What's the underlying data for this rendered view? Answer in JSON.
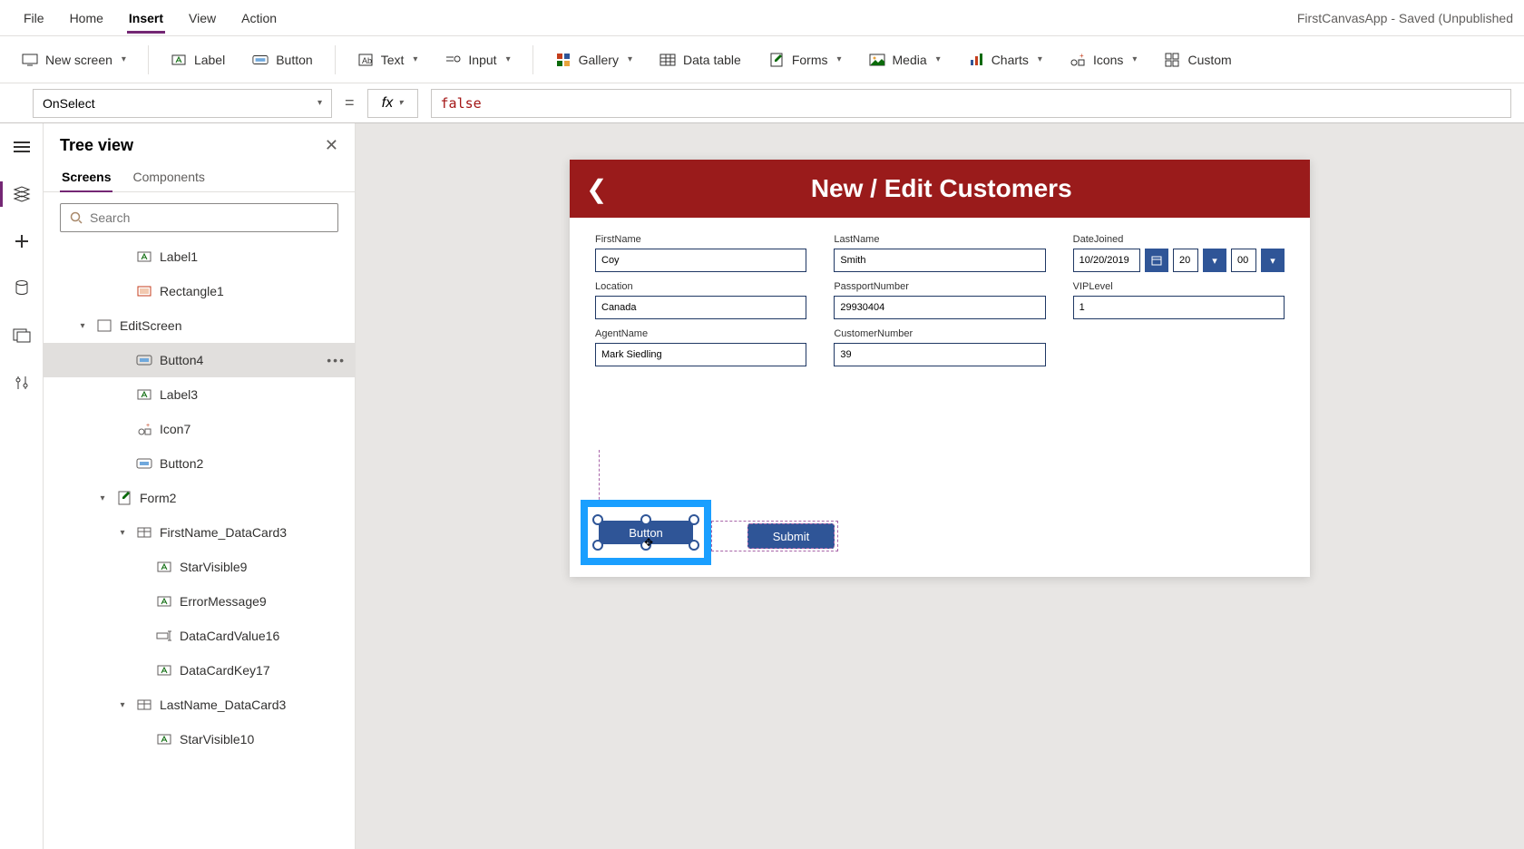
{
  "app_title": "FirstCanvasApp - Saved (Unpublished",
  "menubar": [
    "File",
    "Home",
    "Insert",
    "View",
    "Action"
  ],
  "menubar_active": 2,
  "ribbon": {
    "new_screen": "New screen",
    "label": "Label",
    "button": "Button",
    "text": "Text",
    "input": "Input",
    "gallery": "Gallery",
    "data_table": "Data table",
    "forms": "Forms",
    "media": "Media",
    "charts": "Charts",
    "icons": "Icons",
    "custom": "Custom"
  },
  "formula": {
    "property": "OnSelect",
    "fx": "fx",
    "value": "false"
  },
  "tree": {
    "title": "Tree view",
    "tabs": [
      "Screens",
      "Components"
    ],
    "tabs_active": 0,
    "search_placeholder": "Search",
    "items": [
      {
        "indent": 3,
        "icon": "label",
        "label": "Label1"
      },
      {
        "indent": 3,
        "icon": "rect",
        "label": "Rectangle1"
      },
      {
        "indent": 1,
        "icon": "screen",
        "label": "EditScreen",
        "caret": "v"
      },
      {
        "indent": 3,
        "icon": "button",
        "label": "Button4",
        "selected": true,
        "dots": true
      },
      {
        "indent": 3,
        "icon": "label",
        "label": "Label3"
      },
      {
        "indent": 3,
        "icon": "icon",
        "label": "Icon7"
      },
      {
        "indent": 3,
        "icon": "button",
        "label": "Button2"
      },
      {
        "indent": 2,
        "icon": "form",
        "label": "Form2",
        "caret": "v"
      },
      {
        "indent": 3,
        "icon": "card",
        "label": "FirstName_DataCard3",
        "caret": "v"
      },
      {
        "indent": 4,
        "icon": "label",
        "label": "StarVisible9"
      },
      {
        "indent": 4,
        "icon": "label",
        "label": "ErrorMessage9"
      },
      {
        "indent": 4,
        "icon": "input",
        "label": "DataCardValue16"
      },
      {
        "indent": 4,
        "icon": "label",
        "label": "DataCardKey17"
      },
      {
        "indent": 3,
        "icon": "card",
        "label": "LastName_DataCard3",
        "caret": "v"
      },
      {
        "indent": 4,
        "icon": "label",
        "label": "StarVisible10"
      }
    ]
  },
  "form": {
    "title": "New / Edit Customers",
    "fields": {
      "firstname": {
        "label": "FirstName",
        "value": "Coy"
      },
      "lastname": {
        "label": "LastName",
        "value": "Smith"
      },
      "datejoined": {
        "label": "DateJoined",
        "date": "10/20/2019",
        "hour": "20",
        "minute": "00"
      },
      "location": {
        "label": "Location",
        "value": "Canada"
      },
      "passport": {
        "label": "PassportNumber",
        "value": "29930404"
      },
      "vip": {
        "label": "VIPLevel",
        "value": "1"
      },
      "agent": {
        "label": "AgentName",
        "value": "Mark Siedling"
      },
      "custnum": {
        "label": "CustomerNumber",
        "value": "39"
      }
    },
    "button_label": "Button",
    "submit_label": "Submit"
  }
}
